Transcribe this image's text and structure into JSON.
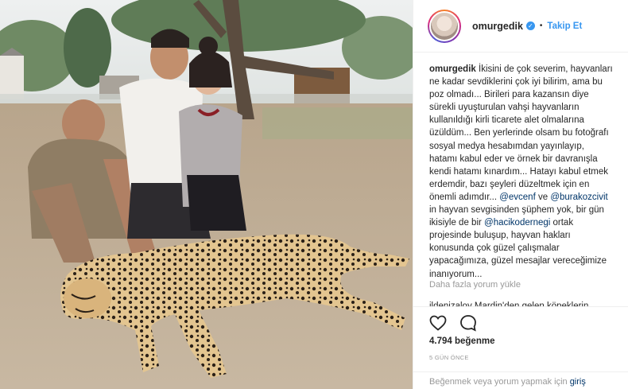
{
  "post": {
    "username": "omurgedik",
    "verified_mark": "✓",
    "separator": "•",
    "follow_label": "Takip Et",
    "avatar_icon": "avatar-photo",
    "photo_alt": "Photo of three people posing with a resting cheetah"
  },
  "caption": {
    "username": "omurgedik",
    "text_part1": "İkisini de çok severim, hayvanları ne kadar sevdiklerini çok iyi bilirim, ama bu poz olmadı... Birileri para kazansın diye sürekli uyuşturulan vahşi hayvanların kullanıldığı kirli ticarete alet olmalarına üzüldüm... Ben yerlerinde olsam bu fotoğrafı sosyal medya hesabımdan yayınlayıp, hatamı kabul eder ve örnek bir davranışla kendi hatamı kınardım... Hatayı kabul etmek erdemdir, bazı şeyleri düzeltmek için en önemli adımdır...",
    "mention1": "@evcenf",
    "conj": " ve ",
    "mention2": "@burakozcivit",
    "text_part2": " in hayvan sevgisinden şüphem yok, bir gün ikisiyle de bir ",
    "mention3": "@hacikodernegi",
    "text_part3": " ortak projesinde buluşup, hayvan hakları konusunda çok güzel çalışmalar yapacağımıza, güzel mesajlar vereceğimize inanıyorum..."
  },
  "comments": {
    "load_more": "Daha fazla yorum yükle",
    "partial": "ildenizaloy Mardin'den gelen köpeklerin"
  },
  "actions": {
    "like_icon": "heart-icon",
    "comment_icon": "comment-icon",
    "likes": "4.794 beğenme",
    "time": "5 GÜN ÖNCE"
  },
  "login": {
    "prompt": "Beğenmek veya yorum yapmak için ",
    "link": "giriş"
  },
  "colors": {
    "link": "#003569",
    "follow": "#3897f0",
    "muted": "#999999",
    "border": "#efefef"
  }
}
